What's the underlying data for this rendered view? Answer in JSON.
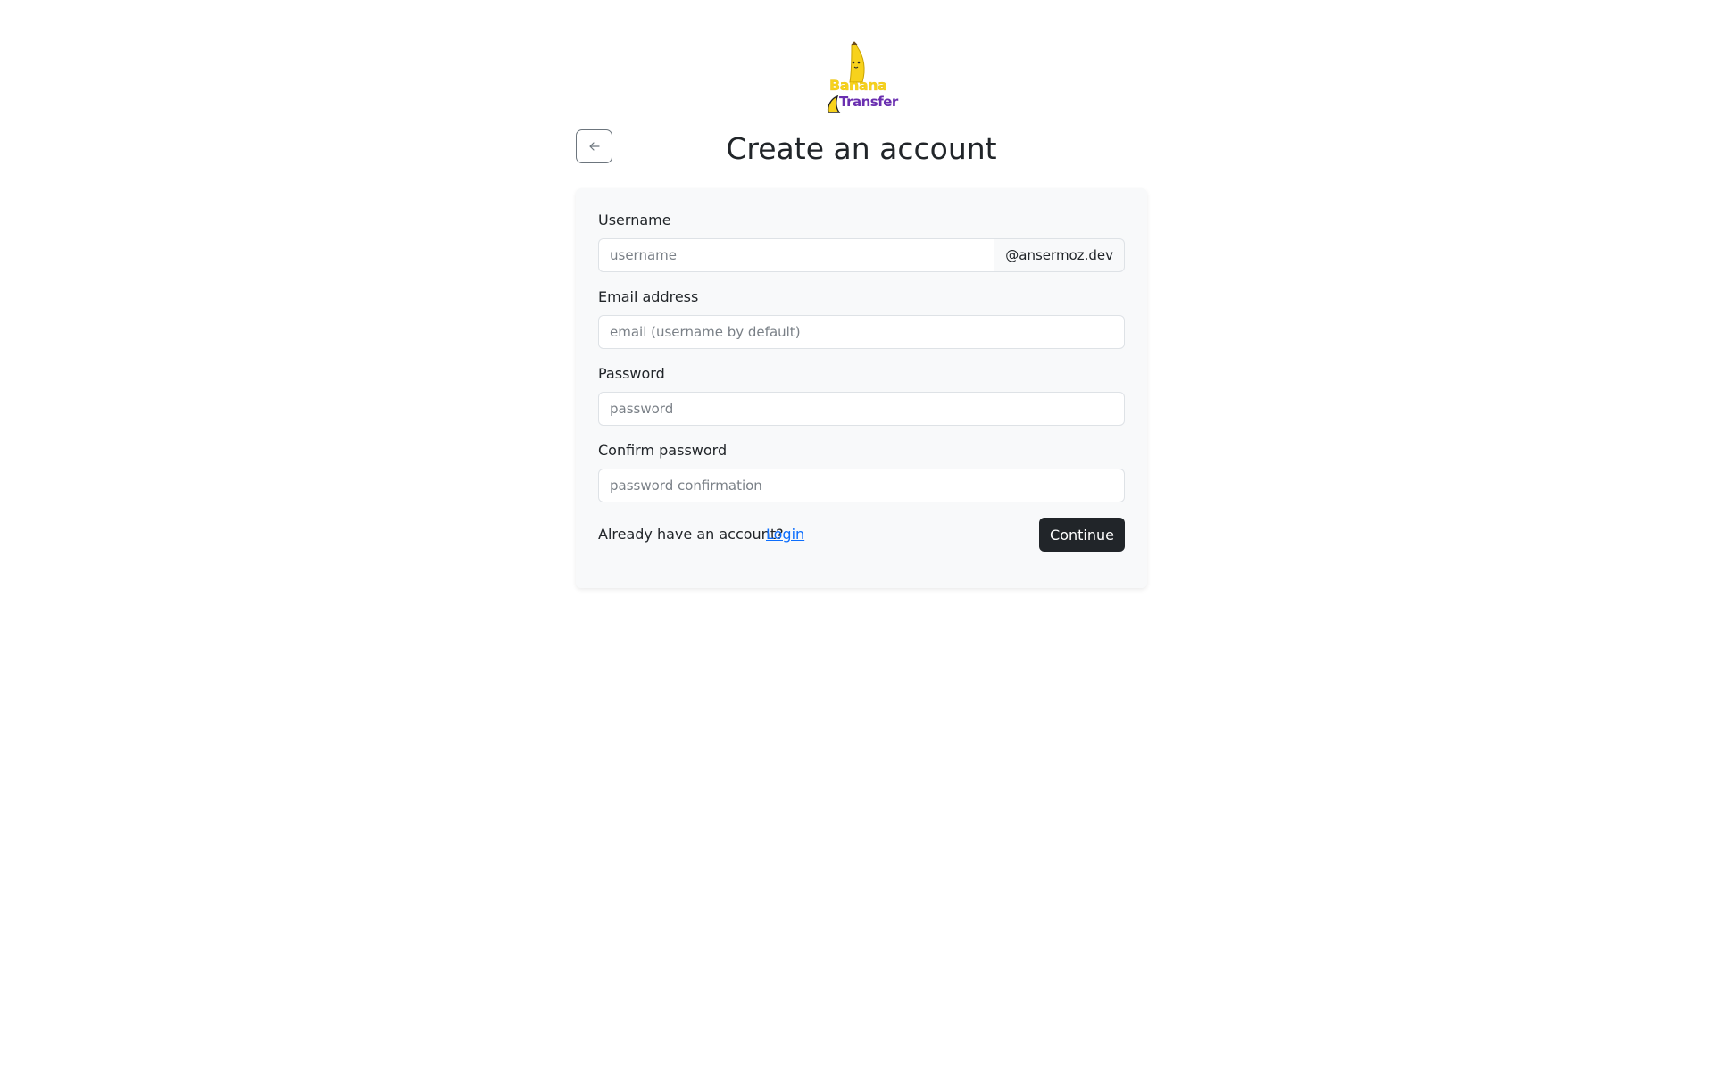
{
  "logo": {
    "line1": "Banana",
    "line2": "Transfer",
    "icon": "banana-mascot-icon"
  },
  "header": {
    "back_icon": "arrow-left-icon",
    "title": "Create an account"
  },
  "form": {
    "username": {
      "label": "Username",
      "placeholder": "username",
      "value": "",
      "suffix": "@ansermoz.dev"
    },
    "email": {
      "label": "Email address",
      "placeholder": "email (username by default)",
      "value": ""
    },
    "password": {
      "label": "Password",
      "placeholder": "password",
      "value": ""
    },
    "confirm_password": {
      "label": "Confirm password",
      "placeholder": "password confirmation",
      "value": ""
    },
    "footer": {
      "already_text": "Already have an account?",
      "login_label": "Login",
      "continue_label": "Continue"
    }
  },
  "colors": {
    "primary_dark": "#212529",
    "link": "#0d6efd",
    "card_bg": "#f8f9fa",
    "logo_yellow": "#f7d21c",
    "logo_purple": "#6a2fb0"
  }
}
